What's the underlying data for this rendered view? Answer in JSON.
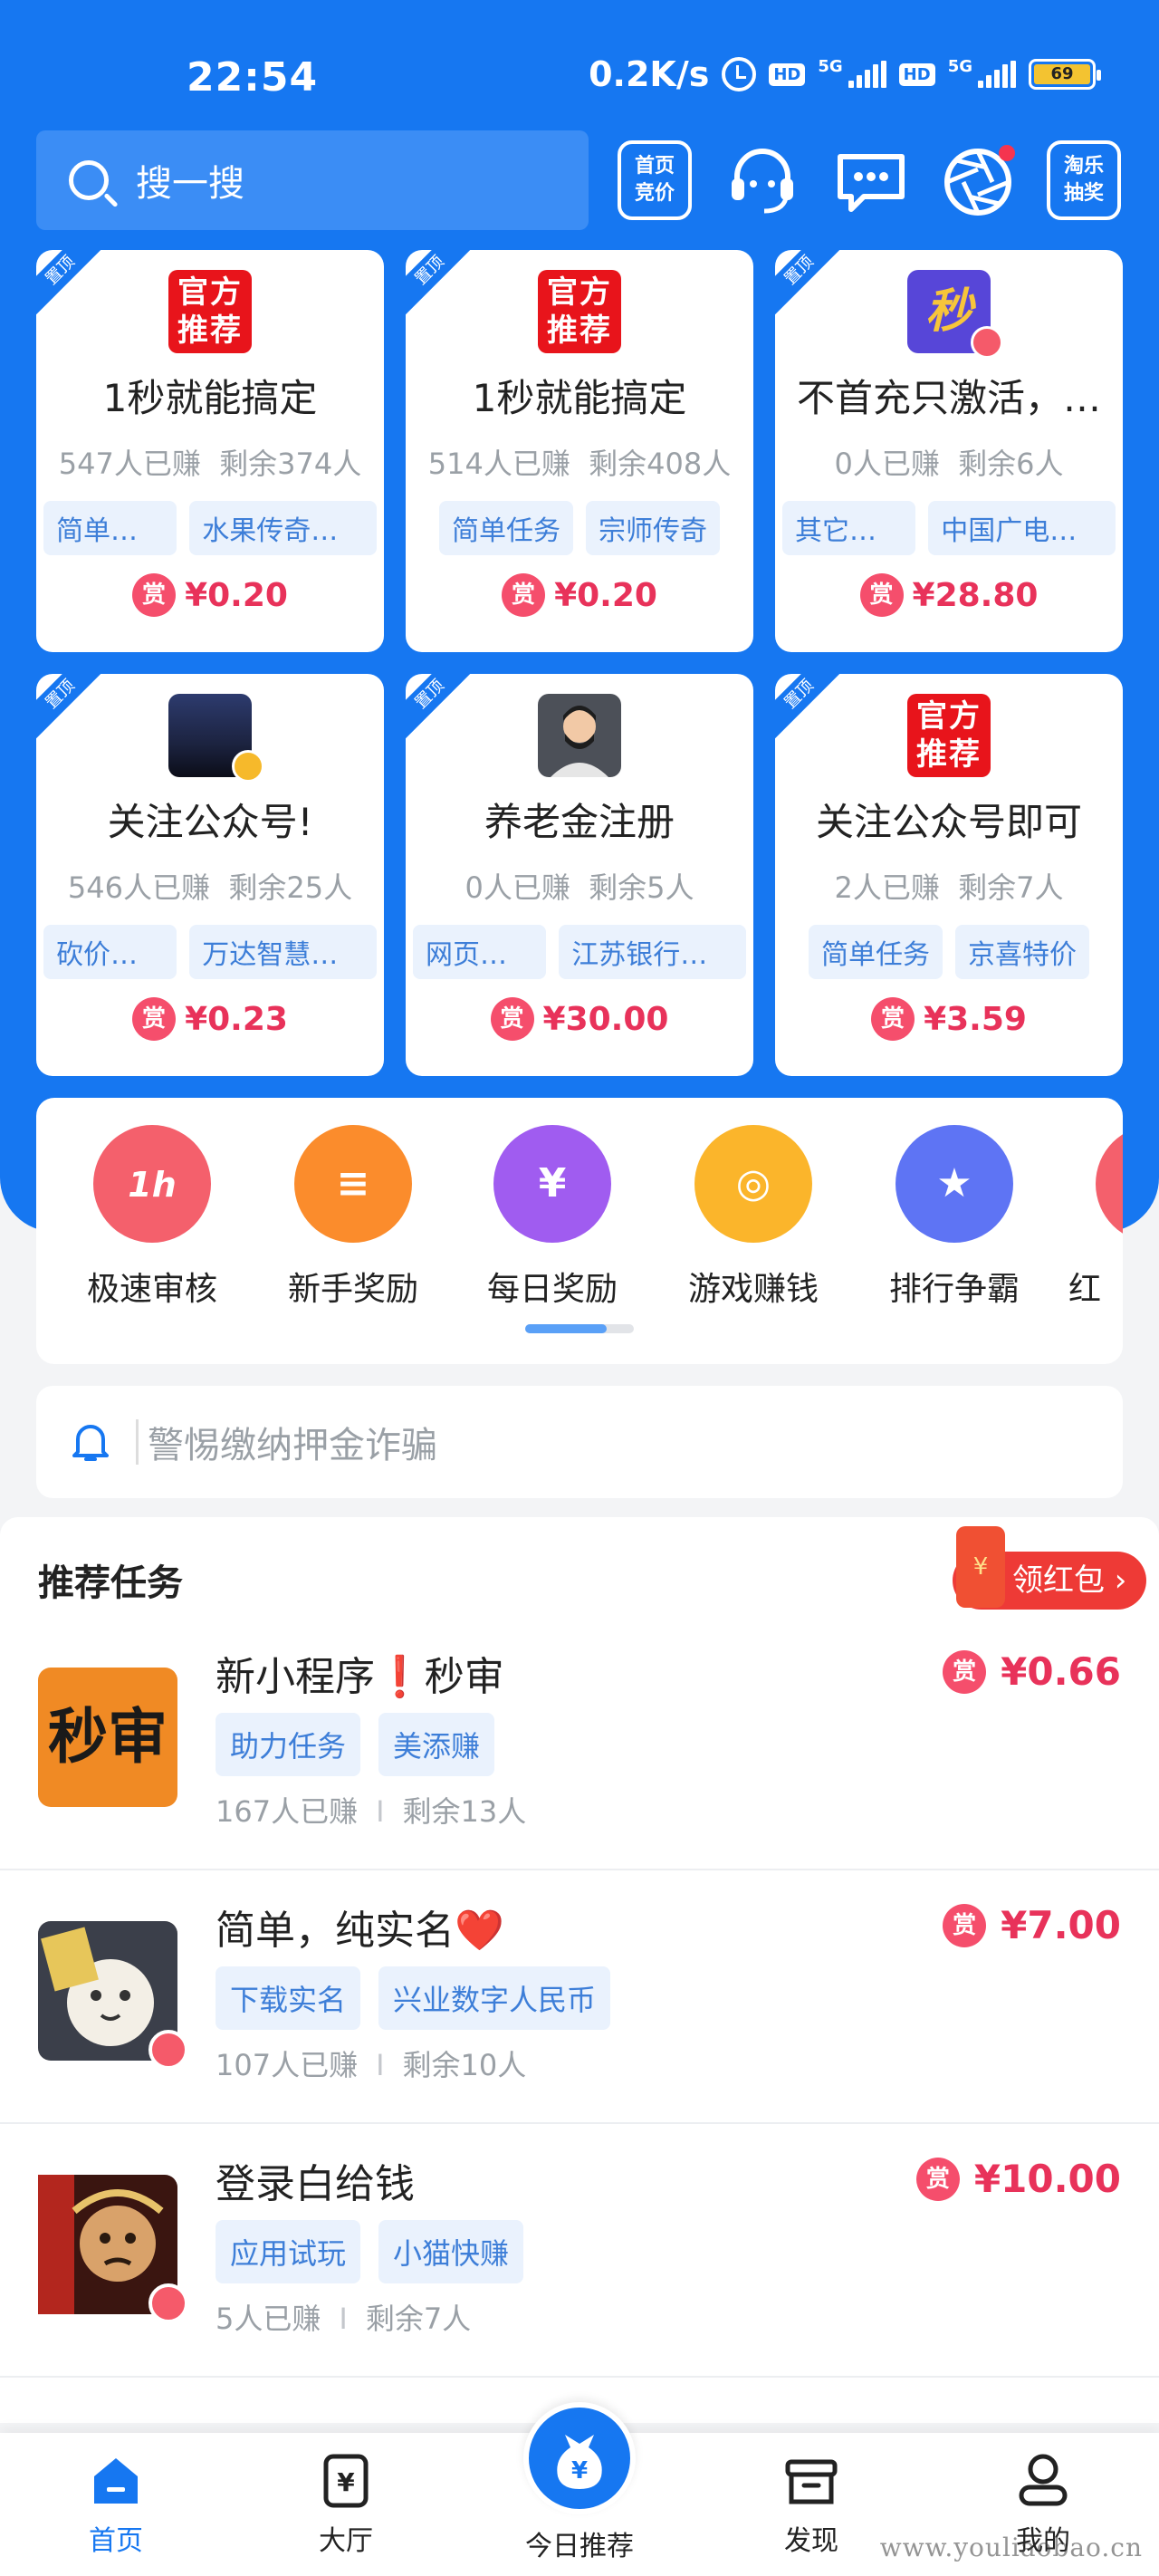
{
  "status_bar": {
    "time": "22:54",
    "net_speed": "0.2K/s",
    "hd1": "HD",
    "net1": "5G",
    "hd2": "HD",
    "net2": "5G",
    "battery": "69"
  },
  "header": {
    "search_placeholder": "搜一搜",
    "bid_button": [
      "首页",
      "竞价"
    ],
    "lottery_button": [
      "淘乐",
      "抽奖"
    ]
  },
  "pin_label": "置顶",
  "reward_badge": "赏",
  "top_cards": [
    {
      "logo": [
        "官方",
        "推荐"
      ],
      "title": "1秒就能搞定",
      "earned": "547人已赚",
      "remaining": "剩余374人",
      "tags": [
        "简单任务",
        "水果传奇世界"
      ],
      "reward": "¥0.20"
    },
    {
      "logo": [
        "官方",
        "推荐"
      ],
      "title": "1秒就能搞定",
      "earned": "514人已赚",
      "remaining": "剩余408人",
      "tags": [
        "简单任务",
        "宗师传奇"
      ],
      "reward": "¥0.20"
    },
    {
      "logo_text": "秒",
      "title": "不首充只激活，…",
      "earned": "0人已赚",
      "remaining": "剩余6人",
      "tags": [
        "其它任务",
        "中国广电福…"
      ],
      "reward": "¥28.80"
    },
    {
      "title": "关注公众号!",
      "earned": "546人已赚",
      "remaining": "剩余25人",
      "tags": [
        "砍价互助",
        "万达智慧商业"
      ],
      "reward": "¥0.23"
    },
    {
      "title": "养老金注册",
      "earned": "0人已赚",
      "remaining": "剩余5人",
      "tags": [
        "网页实名",
        "江苏银行养…"
      ],
      "reward": "¥30.00"
    },
    {
      "logo": [
        "官方",
        "推荐"
      ],
      "title": "关注公众号即可",
      "earned": "2人已赚",
      "remaining": "剩余7人",
      "tags": [
        "简单任务",
        "京喜特价"
      ],
      "reward": "¥3.59"
    }
  ],
  "categories": [
    {
      "label": "极速审核",
      "icon_text": "1h",
      "color": "#f4606c"
    },
    {
      "label": "新手奖励",
      "icon_text": "≡",
      "color": "#fb8c2c"
    },
    {
      "label": "每日奖励",
      "icon_text": "¥",
      "color": "#a05cf0"
    },
    {
      "label": "游戏赚钱",
      "icon_text": "◎",
      "color": "#fbb52b"
    },
    {
      "label": "排行争霸",
      "icon_text": "★",
      "color": "#5e74f4"
    },
    {
      "label": "红",
      "icon_text": "",
      "color": "#f4606c"
    }
  ],
  "notice": {
    "text": "警惕缴纳押金诈骗"
  },
  "recommended": {
    "title": "推荐任务",
    "red_packet": "领红包",
    "red_packet_icon": "¥",
    "items": [
      {
        "name": "新小程序❗秒审",
        "tags": [
          "助力任务",
          "美添赚"
        ],
        "earned": "167人已赚",
        "remaining": "剩余13人",
        "reward": "¥0.66",
        "thumb_text": "秒审"
      },
      {
        "name": "简单，纯实名❤️",
        "tags": [
          "下载实名",
          "兴业数字人民币"
        ],
        "earned": "107人已赚",
        "remaining": "剩余10人",
        "reward": "¥7.00"
      },
      {
        "name": "登录白给钱",
        "tags": [
          "应用试玩",
          "小猫快赚"
        ],
        "earned": "5人已赚",
        "remaining": "剩余7人",
        "reward": "¥10.00"
      }
    ],
    "separator": "I"
  },
  "bottom_nav": [
    {
      "label": "首页",
      "icon": "home-icon",
      "active": true
    },
    {
      "label": "大厅",
      "icon": "hall-icon"
    },
    {
      "label": "今日推荐",
      "icon": "money-bag-icon"
    },
    {
      "label": "发现",
      "icon": "discover-icon"
    },
    {
      "label": "我的",
      "icon": "profile-icon"
    }
  ],
  "watermark": "www.youliaobao.cn"
}
